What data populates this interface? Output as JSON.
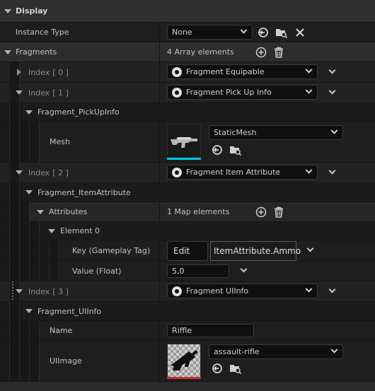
{
  "section": {
    "title": "Display"
  },
  "instance_type": {
    "label": "Instance Type",
    "value": "None"
  },
  "fragments": {
    "label": "Fragments",
    "count": "4 Array elements"
  },
  "index0": {
    "label": "Index",
    "num": "[ 0 ]",
    "value": "Fragment Equipable"
  },
  "index1": {
    "label": "Index",
    "num": "[ 1 ]",
    "value": "Fragment Pick Up Info"
  },
  "pickup": {
    "title": "Fragment_PickUpInfo",
    "mesh_label": "Mesh",
    "mesh_value": "StaticMesh"
  },
  "index2": {
    "label": "Index",
    "num": "[ 2 ]",
    "value": "Fragment Item Attribute"
  },
  "itemattr": {
    "title": "Fragment_ItemAttribute",
    "attributes_label": "Attributes",
    "attributes_count": "1 Map elements",
    "element0": "Element 0",
    "key_label": "Key (Gameplay Tag)",
    "edit_label": "Edit",
    "key_value": "ItemAttribute.Ammo",
    "value_label": "Value (Float)",
    "value_value": "5,0"
  },
  "index3": {
    "label": "Index",
    "num": "[ 3 ]",
    "value": "Fragment UIInfo"
  },
  "uiinfo": {
    "title": "Fragment_UIInfo",
    "name_label": "Name",
    "name_value": "Riffle",
    "image_label": "UIImage",
    "image_value": "assault-rifle"
  },
  "colors": {
    "mesh_accent": "#00c8e0",
    "texture_accent": "#c83232"
  }
}
